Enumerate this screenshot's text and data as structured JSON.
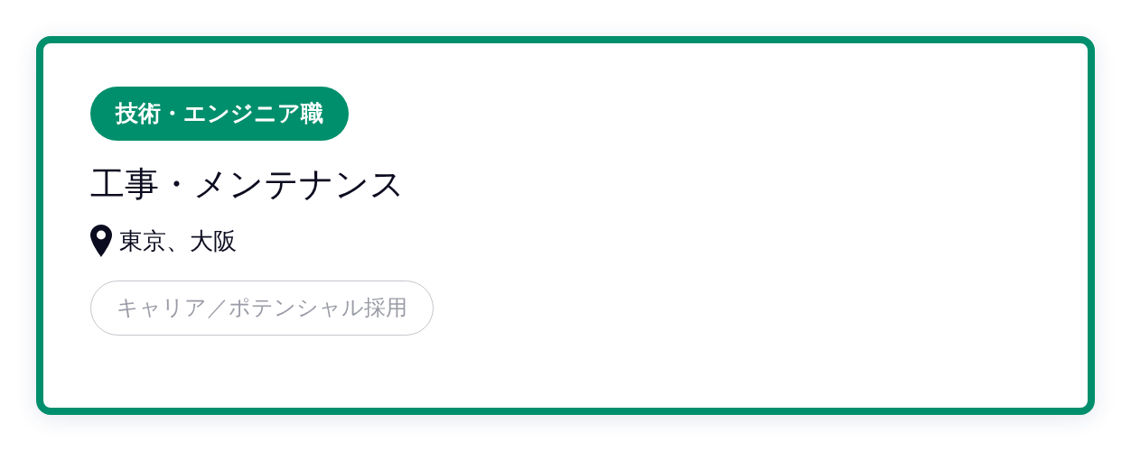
{
  "card": {
    "category": "技術・エンジニア職",
    "title": "工事・メンテナンス",
    "location": "東京、大阪",
    "tags": [
      "キャリア／ポテンシャル採用"
    ]
  }
}
